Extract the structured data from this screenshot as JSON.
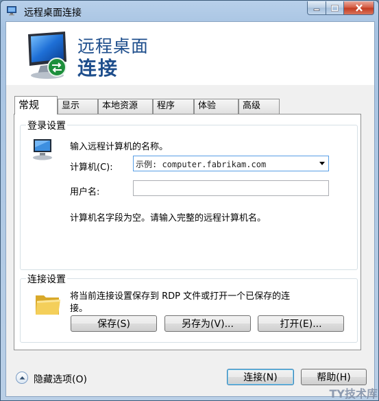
{
  "window": {
    "title": "远程桌面连接"
  },
  "banner": {
    "line1": "远程桌面",
    "line2": "连接"
  },
  "tabs": [
    {
      "label": "常规",
      "active": true
    },
    {
      "label": "显示",
      "active": false
    },
    {
      "label": "本地资源",
      "active": false
    },
    {
      "label": "程序",
      "active": false
    },
    {
      "label": "体验",
      "active": false
    },
    {
      "label": "高级",
      "active": false
    }
  ],
  "logon": {
    "legend": "登录设置",
    "prompt": "输入远程计算机的名称。",
    "computer_label": "计算机(C):",
    "computer_value": "示例: computer.fabrikam.com",
    "username_label": "用户名:",
    "username_value": "",
    "status": "计算机名字段为空。请输入完整的远程计算机名。"
  },
  "connection": {
    "legend": "连接设置",
    "desc_line1": "将当前连接设置保存到 RDP 文件或打开一个已保存的连",
    "desc_line2": "接。",
    "save_label": "保存(S)",
    "save_as_label": "另存为(V)...",
    "open_label": "打开(E)..."
  },
  "footer": {
    "hide_options_label": "隐藏选项(O)",
    "connect_label": "连接(N)",
    "help_label": "帮助(H)"
  },
  "watermark": "TY技术库",
  "colors": {
    "banner_text": "#1e4e8c",
    "titlebar": "#b8d0ea",
    "close_button": "#c23a20"
  }
}
